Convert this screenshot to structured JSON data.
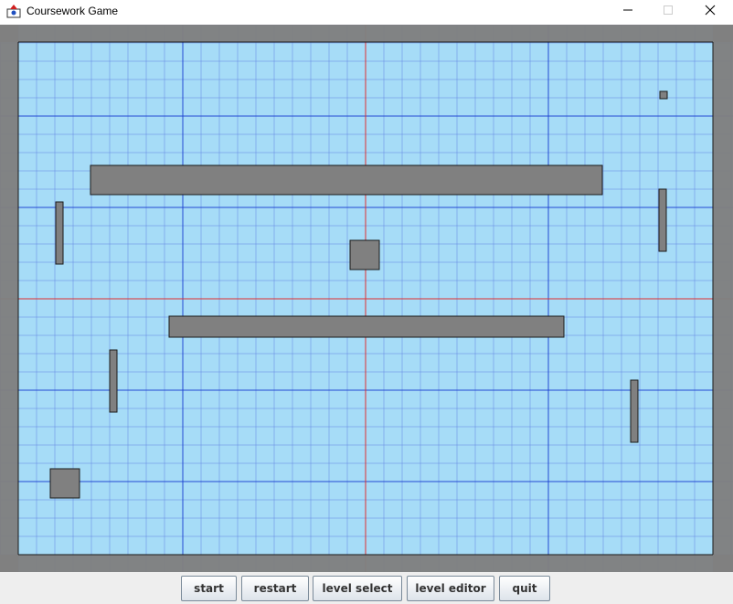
{
  "window": {
    "title": "Coursework Game",
    "icons": {
      "app": "java-app-icon",
      "minimize": "minimize-icon",
      "maximize": "maximize-icon",
      "close": "close-icon"
    }
  },
  "game": {
    "colors": {
      "background": "#a6dcf7",
      "fine_grid": "#5a7de0",
      "major_grid": "#1a3fcf",
      "center_axis": "#e03030",
      "wall": "#808080",
      "platform_fill": "#808080",
      "platform_stroke": "#1a1a1a"
    },
    "grid": "on"
  },
  "buttons": {
    "start": "start",
    "restart": "restart",
    "level_select": "level select",
    "level_editor": "level editor",
    "quit": "quit"
  }
}
